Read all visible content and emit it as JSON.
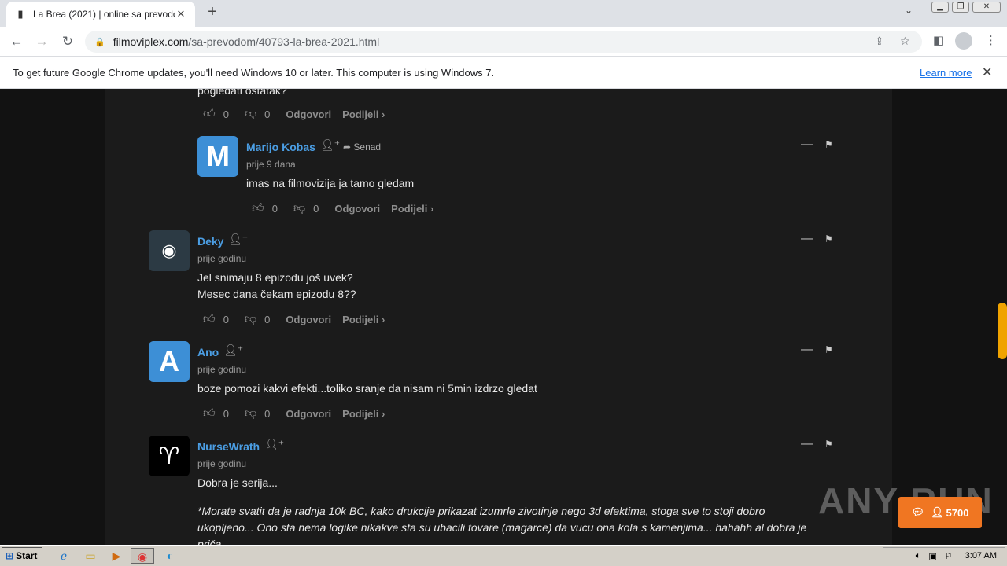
{
  "browser": {
    "tab_title": "La Brea (2021) | online sa prevodom",
    "url_domain": "filmoviplex.com",
    "url_path": "/sa-prevodom/40793-la-brea-2021.html",
    "new_tab_symbol": "+",
    "tab_close_symbol": "✕"
  },
  "infobar": {
    "message": "To get future Google Chrome updates, you'll need Windows 10 or later. This computer is using Windows 7.",
    "link": "Learn more"
  },
  "actions": {
    "reply": "Odgovori",
    "share": "Podijeli ›"
  },
  "partial_comment": {
    "text": "pogledati ostatak?",
    "likes": "0",
    "dislikes": "0"
  },
  "comments": [
    {
      "initial": "M",
      "avatar_color": "#3d8fd6",
      "name": "Marijo Kobas",
      "reply_to": "Senad",
      "time": "prije 9 dana",
      "lines": [
        "imas na filmovizija ja tamo gledam"
      ],
      "likes": "0",
      "dislikes": "0"
    },
    {
      "initial": "",
      "avatar_color": "#2c3a44",
      "name": "Deky",
      "time": "prije godinu",
      "lines": [
        "Jel snimaju 8 epizodu još uvek?",
        "Mesec dana čekam epizodu 8??"
      ],
      "likes": "0",
      "dislikes": "0"
    },
    {
      "initial": "A",
      "avatar_color": "#3d8fd6",
      "name": "Ano",
      "time": "prije godinu",
      "lines": [
        "boze pomozi kakvi efekti...toliko sranje da nisam ni 5min izdrzo gledat"
      ],
      "likes": "0",
      "dislikes": "0"
    },
    {
      "initial": "",
      "avatar_color": "#000000",
      "name": "NurseWrath",
      "time": "prije godinu",
      "lines": [
        "Dobra je serija..."
      ],
      "italic_lines": [
        "*Morate svatit da je radnja 10k BC, kako drukcije prikazat izumrle zivotinje nego 3d efektima, stoga sve to stoji dobro",
        "ukopljeno... Ono sta nema logike nikakve sta su ubacili tovare (magarce) da vucu ona kola s kamenjima... hahahh al dobra je",
        "priča..."
      ]
    }
  ],
  "chat": {
    "count": "5700"
  },
  "watermark": "ANY RUN",
  "taskbar": {
    "start": "Start",
    "time": "3:07 AM"
  }
}
